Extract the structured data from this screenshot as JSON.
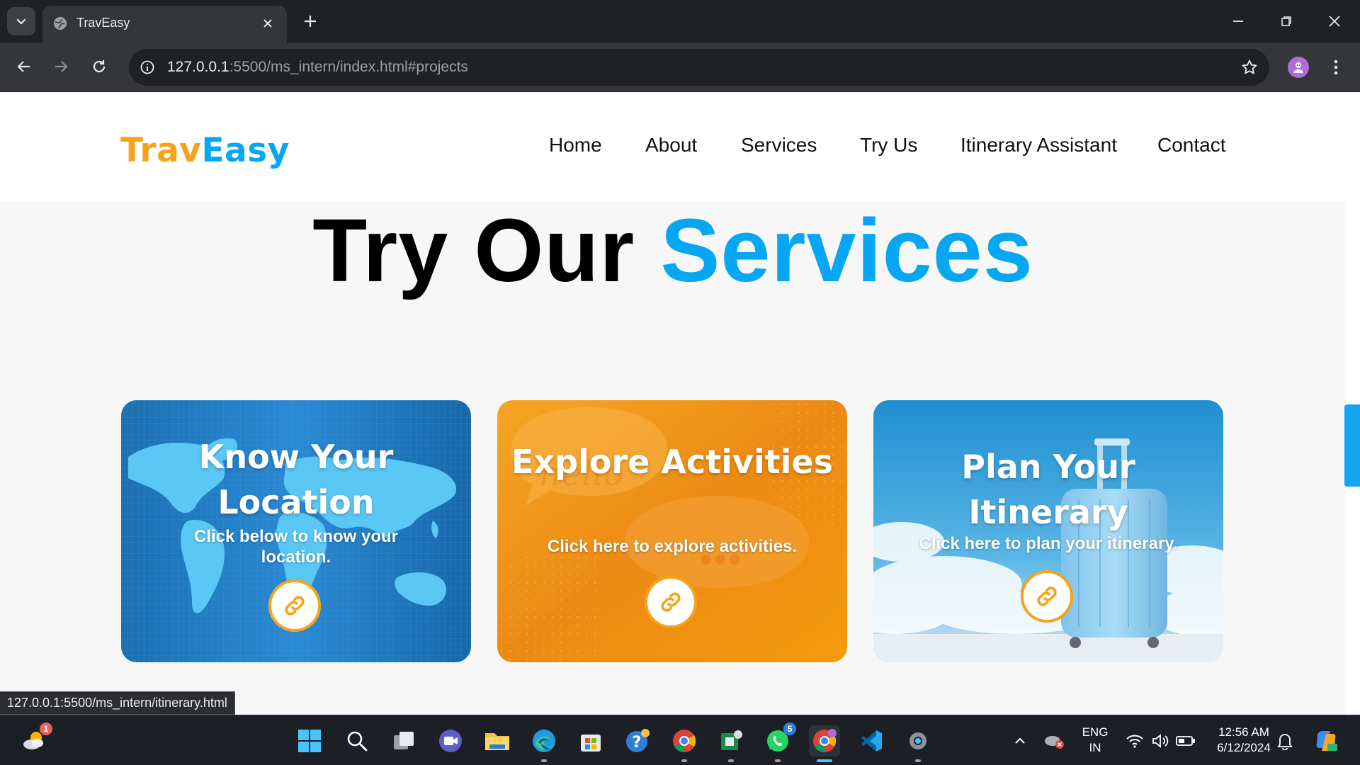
{
  "browser": {
    "tab_title": "TravEasy",
    "url_host": "127.0.0.1",
    "url_rest": ":5500/ms_intern/index.html#projects",
    "status_url": "127.0.0.1:5500/ms_intern/itinerary.html"
  },
  "site": {
    "logo_part1": "Trav",
    "logo_part2": "Easy",
    "nav": [
      "Home",
      "About",
      "Services",
      "Try Us",
      "Itinerary Assistant",
      "Contact"
    ],
    "heading_part1": "Try Our",
    "heading_part2": "Services",
    "cards": [
      {
        "title": "Know Your Location",
        "subtitle": "Click below to know your location."
      },
      {
        "title": "Explore Activities",
        "subtitle": "Click here to explore activities."
      },
      {
        "title": "Plan Your Itinerary",
        "subtitle": "Click here to plan your itinerary."
      }
    ]
  },
  "taskbar": {
    "weather_badge": "1",
    "whatsapp_badge": "5",
    "language_line1": "ENG",
    "language_line2": "IN",
    "time": "12:56 AM",
    "date": "6/12/2024"
  },
  "colors": {
    "brand_orange": "#f7a21b",
    "brand_blue": "#06a7f2"
  },
  "icons": [
    "tab-search-icon",
    "globe-icon",
    "close-icon",
    "plus-icon",
    "minimize-icon",
    "restore-icon",
    "back-icon",
    "forward-icon",
    "reload-icon",
    "info-icon",
    "star-icon",
    "menu-icon",
    "link-icon",
    "windows-start-icon",
    "search-icon",
    "task-view-icon",
    "meet-icon",
    "folder-icon",
    "edge-icon",
    "store-icon",
    "help-icon",
    "chrome-icon",
    "whatsapp-icon",
    "vscode-icon",
    "settings-icon",
    "wifi-icon",
    "volume-icon",
    "battery-icon",
    "bell-icon"
  ]
}
